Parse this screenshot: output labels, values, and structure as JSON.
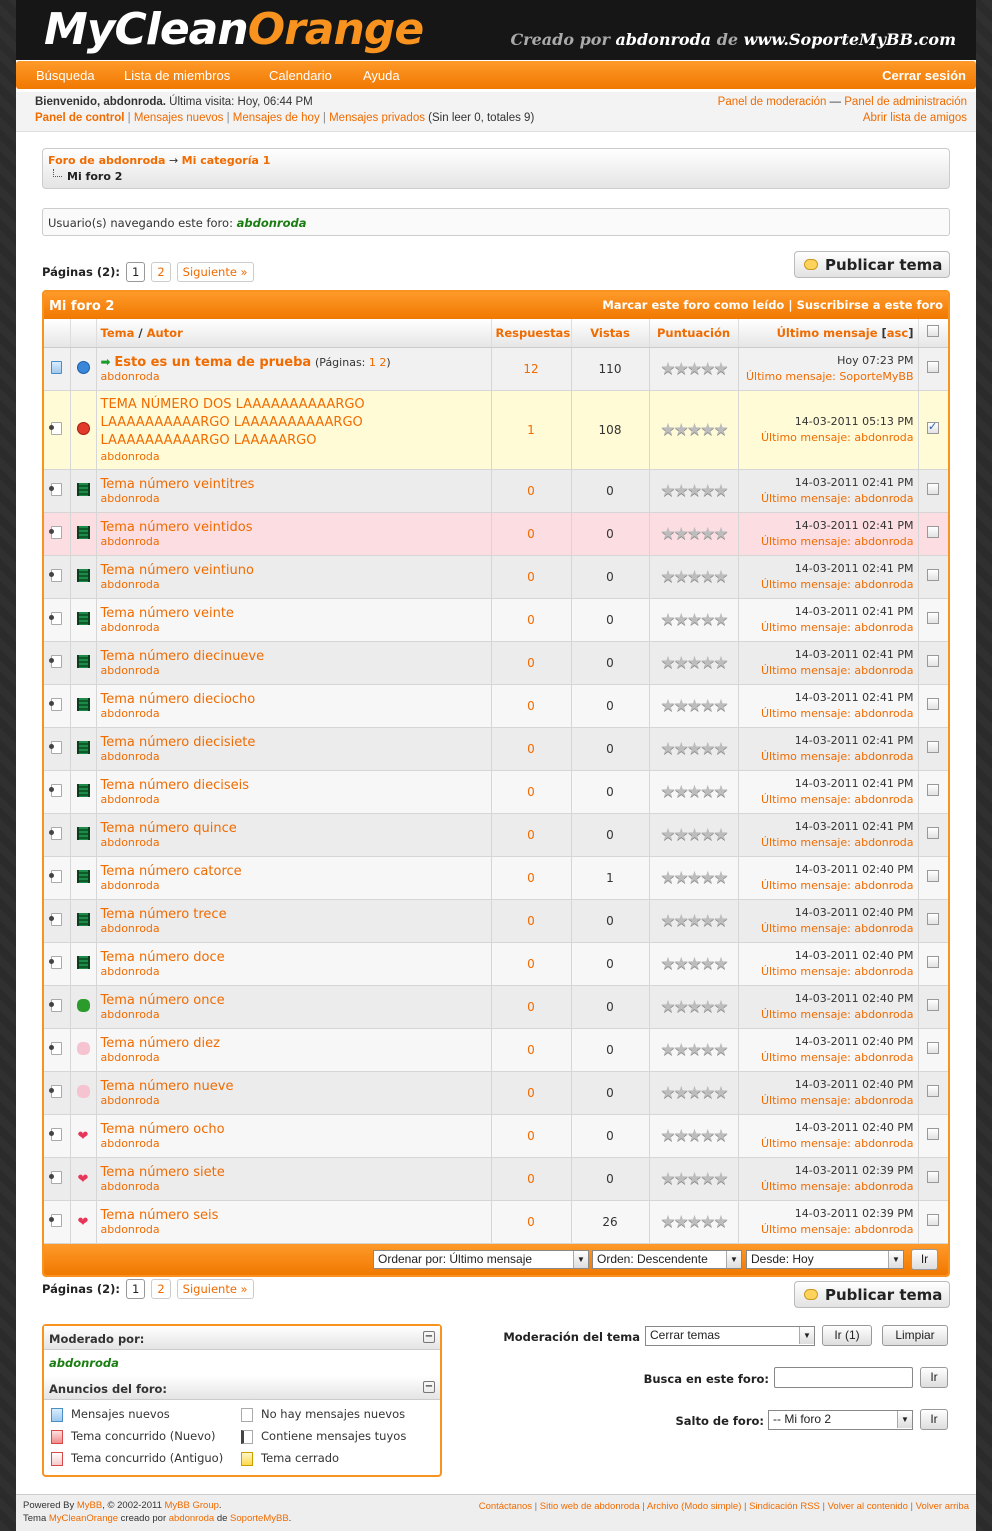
{
  "header": {
    "logo_white": "MyClean",
    "logo_orange": "Orange",
    "credit_pre": "Creado por ",
    "credit_user": "abdonroda",
    "credit_mid": " de ",
    "credit_site": "www.SoporteMyBB.com"
  },
  "nav": {
    "items": [
      "Búsqueda",
      "Lista de miembros",
      "Calendario",
      "Ayuda"
    ],
    "logout": "Cerrar sesión"
  },
  "welcome": {
    "greeting": "Bienvenido, abdonroda.",
    "last_visit": " Última visita: Hoy, 06:44 PM",
    "control_panel": "Panel de control",
    "new_posts": "Mensajes nuevos",
    "today_posts": "Mensajes de hoy",
    "pms": "Mensajes privados",
    "pm_counts": " (Sin leer 0, totales 9)",
    "mod_panel": "Panel de moderación",
    "dash": " — ",
    "admin_panel": "Panel de administración",
    "buddy_list": "Abrir lista de amigos"
  },
  "breadcrumb": {
    "forum": "Foro de abdonroda",
    "arrow": "→",
    "category": "Mi categoría 1",
    "current": "Mi foro 2"
  },
  "viewers": {
    "label": "Usuario(s) navegando este foro: ",
    "user": "abdonroda"
  },
  "pagination": {
    "label": "Páginas (2):",
    "pages": [
      "1",
      "2"
    ],
    "next": "Siguiente »"
  },
  "new_thread_label": "Publicar tema",
  "forum_table": {
    "title": "Mi foro 2",
    "mark_read": "Marcar este foro como leído",
    "pipe": " | ",
    "subscribe": "Suscribirse a este foro",
    "columns": {
      "thread": "Tema",
      "slash": " / ",
      "author": "Autor",
      "replies": "Respuestas",
      "views": "Vistas",
      "rating": "Puntuación",
      "lastpost": "Último mensaje",
      "asc": "asc"
    },
    "sticky": {
      "title": "Esto es un tema de prueba",
      "pages_label": "(Páginas: ",
      "pages": "1 2",
      "pages_close": ")",
      "author": "abdonroda",
      "replies": "12",
      "views": "110",
      "last_date": "Hoy 07:23 PM",
      "last_label": "Último mensaje: ",
      "last_user": "SoporteMyBB"
    },
    "selected": {
      "title": "TEMA NÚMERO DOS LAAAAAAAAAARGO LAAAAAAAAAARGO LAAAAAAAAAARGO LAAAAAAAAAARGO LAAAAARGO",
      "author": "abdonroda",
      "replies": "1",
      "views": "108",
      "last_date": "14-03-2011 05:13 PM",
      "last_label": "Último mensaje: ",
      "last_user": "abdonroda"
    },
    "threads": [
      {
        "title": "Tema número veintitres",
        "author": "abdonroda",
        "replies": "0",
        "views": "0",
        "date": "14-03-2011 02:41 PM",
        "last_user": "abdonroda",
        "icon": "film-icon"
      },
      {
        "title": "Tema número veintidos",
        "author": "abdonroda",
        "replies": "0",
        "views": "0",
        "date": "14-03-2011 02:41 PM",
        "last_user": "abdonroda",
        "icon": "film-icon"
      },
      {
        "title": "Tema número veintiuno",
        "author": "abdonroda",
        "replies": "0",
        "views": "0",
        "date": "14-03-2011 02:41 PM",
        "last_user": "abdonroda",
        "icon": "film-icon"
      },
      {
        "title": "Tema número veinte",
        "author": "abdonroda",
        "replies": "0",
        "views": "0",
        "date": "14-03-2011 02:41 PM",
        "last_user": "abdonroda",
        "icon": "film-icon"
      },
      {
        "title": "Tema número diecinueve",
        "author": "abdonroda",
        "replies": "0",
        "views": "0",
        "date": "14-03-2011 02:41 PM",
        "last_user": "abdonroda",
        "icon": "film-icon"
      },
      {
        "title": "Tema número dieciocho",
        "author": "abdonroda",
        "replies": "0",
        "views": "0",
        "date": "14-03-2011 02:41 PM",
        "last_user": "abdonroda",
        "icon": "film-icon"
      },
      {
        "title": "Tema número diecisiete",
        "author": "abdonroda",
        "replies": "0",
        "views": "0",
        "date": "14-03-2011 02:41 PM",
        "last_user": "abdonroda",
        "icon": "film-icon"
      },
      {
        "title": "Tema número dieciseis",
        "author": "abdonroda",
        "replies": "0",
        "views": "0",
        "date": "14-03-2011 02:41 PM",
        "last_user": "abdonroda",
        "icon": "film-icon"
      },
      {
        "title": "Tema número quince",
        "author": "abdonroda",
        "replies": "0",
        "views": "0",
        "date": "14-03-2011 02:41 PM",
        "last_user": "abdonroda",
        "icon": "film-icon"
      },
      {
        "title": "Tema número catorce",
        "author": "abdonroda",
        "replies": "0",
        "views": "1",
        "date": "14-03-2011 02:40 PM",
        "last_user": "abdonroda",
        "icon": "film-icon"
      },
      {
        "title": "Tema número trece",
        "author": "abdonroda",
        "replies": "0",
        "views": "0",
        "date": "14-03-2011 02:40 PM",
        "last_user": "abdonroda",
        "icon": "film-icon"
      },
      {
        "title": "Tema número doce",
        "author": "abdonroda",
        "replies": "0",
        "views": "0",
        "date": "14-03-2011 02:40 PM",
        "last_user": "abdonroda",
        "icon": "film-icon"
      },
      {
        "title": "Tema número once",
        "author": "abdonroda",
        "replies": "0",
        "views": "0",
        "date": "14-03-2011 02:40 PM",
        "last_user": "abdonroda",
        "icon": "bug-icon"
      },
      {
        "title": "Tema número diez",
        "author": "abdonroda",
        "replies": "0",
        "views": "0",
        "date": "14-03-2011 02:40 PM",
        "last_user": "abdonroda",
        "icon": "thumbs-up-icon"
      },
      {
        "title": "Tema número nueve",
        "author": "abdonroda",
        "replies": "0",
        "views": "0",
        "date": "14-03-2011 02:40 PM",
        "last_user": "abdonroda",
        "icon": "thumbs-down-icon"
      },
      {
        "title": "Tema número ocho",
        "author": "abdonroda",
        "replies": "0",
        "views": "0",
        "date": "14-03-2011 02:40 PM",
        "last_user": "abdonroda",
        "icon": "heart-icon"
      },
      {
        "title": "Tema número siete",
        "author": "abdonroda",
        "replies": "0",
        "views": "0",
        "date": "14-03-2011 02:39 PM",
        "last_user": "abdonroda",
        "icon": "heart-icon"
      },
      {
        "title": "Tema número seis",
        "author": "abdonroda",
        "replies": "0",
        "views": "26",
        "date": "14-03-2011 02:39 PM",
        "last_user": "abdonroda",
        "icon": "heart-icon"
      }
    ],
    "last_label": "Último mensaje: ",
    "sort_by": "Ordenar por: Último mensaje",
    "order": "Orden: Descendente",
    "since": "Desde: Hoy",
    "go": "Ir"
  },
  "moderated_by": {
    "label": "Moderado por:",
    "user": "abdonroda"
  },
  "announcements": {
    "label": "Anuncios del foro:"
  },
  "legend": [
    {
      "icon": "new-posts-icon",
      "label": "Mensajes nuevos",
      "cls": "new"
    },
    {
      "icon": "hot-new-icon",
      "label": "Tema concurrido (Nuevo)",
      "cls": "hot"
    },
    {
      "icon": "hot-old-icon",
      "label": "Tema concurrido (Antiguo)",
      "cls": "hotold"
    },
    {
      "icon": "no-new-posts-icon",
      "label": "No hay mensajes nuevos",
      "cls": ""
    },
    {
      "icon": "own-posts-icon",
      "label": "Contiene mensajes tuyos",
      "cls": ""
    },
    {
      "icon": "lock-icon",
      "label": "Tema cerrado",
      "cls": "lock"
    }
  ],
  "moderation": {
    "label": "Moderación del tema",
    "select": "Cerrar temas",
    "go": "Ir (1)",
    "clear": "Limpiar"
  },
  "search_forum": {
    "label": "Busca en este foro:",
    "go": "Ir"
  },
  "jump": {
    "label": "Salto de foro:",
    "select": "-- Mi foro 2",
    "go": "Ir"
  },
  "footer": {
    "powered": "Powered By ",
    "mybb": "MyBB",
    "copy": ", © 2002-2011 ",
    "group": "MyBB Group",
    "dot": ".",
    "theme_pre": "Tema ",
    "theme": "MyCleanOrange",
    "theme_mid": " creado por ",
    "author": "abdonroda",
    "de": " de ",
    "site": "SoporteMyBB",
    "links": [
      "Contáctanos",
      "Sitio web de abdonroda",
      "Archivo (Modo simple)",
      "Sindicación RSS",
      "Volver al contenido",
      "Volver arriba"
    ],
    "pipe": " | "
  },
  "colors": {
    "accent": "#f7931e",
    "link": "#f06b00",
    "moderator": "#1b7e12"
  }
}
